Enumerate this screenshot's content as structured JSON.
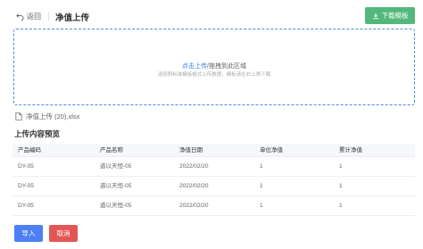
{
  "header": {
    "back_label": "返回",
    "title": "净值上传",
    "download_label": "下载模板"
  },
  "upload": {
    "click_text": "点击上传",
    "drag_text": "/拖拽到此区域",
    "hint": "请按照标准模板格式上传数据，模板请在右上角下载"
  },
  "file": {
    "name": "净值上传 (20).xlsx"
  },
  "preview": {
    "title": "上传内容预览",
    "columns": [
      "产品编码",
      "产品名称",
      "净值日期",
      "单位净值",
      "累计净值"
    ],
    "rows": [
      [
        "DY-05",
        "道以天恒-05",
        "2022/02/20",
        "1",
        "1"
      ],
      [
        "DY-05",
        "道以天恒-05",
        "2022/02/20",
        "1",
        "1"
      ],
      [
        "DY-05",
        "道以天恒-05",
        "2022/02/20",
        "1",
        "1"
      ]
    ]
  },
  "actions": {
    "import_label": "导入",
    "cancel_label": "取消"
  },
  "colors": {
    "primary": "#4d7ff5",
    "success": "#52b87c",
    "danger": "#e45656",
    "link": "#3a7ef0"
  }
}
